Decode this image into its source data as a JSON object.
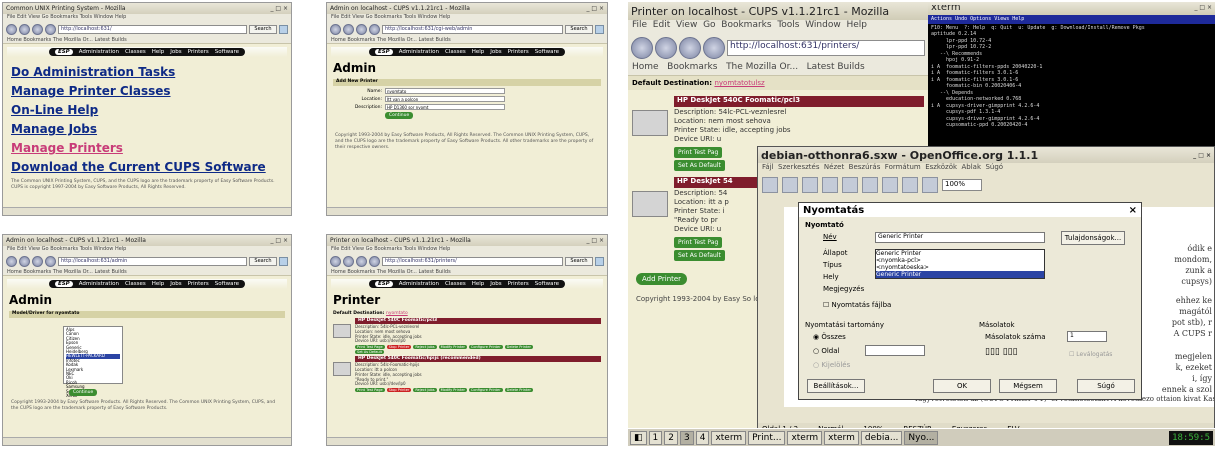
{
  "screens": {
    "s1": {
      "title": "Common UNIX Printing System - Mozilla",
      "url": "http://localhost:631/",
      "links": [
        "Do Administration Tasks",
        "Manage Printer Classes",
        "On-Line Help",
        "Manage Jobs",
        "Manage Printers",
        "Download the Current CUPS Software"
      ],
      "footer": "The Common UNIX Printing System, CUPS, and the CUPS logo are the trademark property of Easy Software Products. CUPS is copyright 1997-2004 by Easy Software Products, All Rights Reserved."
    },
    "s2": {
      "title": "Admin on localhost - CUPS v1.1.21rc1 - Mozilla",
      "url": "http://localhost:631/cgi-web/admin",
      "heading": "Admin",
      "section": "Add New Printer",
      "fields": [
        {
          "label": "Name:",
          "value": "nyomtato"
        },
        {
          "label": "Location:",
          "value": "Itt van a polcon"
        },
        {
          "label": "Description:",
          "value": "HP D1360 sor nyomt"
        }
      ],
      "button": "Continue",
      "footer": "Copyright 1993-2004 by Easy Software Products, All Rights Reserved. The Common UNIX Printing System, CUPS, and the CUPS logo are the trademark property of Easy Software Products. All other trademarks are the property of their respective owners."
    },
    "s3": {
      "title": "Admin on localhost - CUPS v1.1.21rc1 - Mozilla",
      "url": "http://localhost:631/admin",
      "heading": "Admin",
      "section": "Model/Driver for nyomtato",
      "list_label": "Driver:",
      "list": [
        "Alps",
        "Canon",
        "Citizen",
        "Epson",
        "Generic",
        "Heidelberg",
        "HEWLETT-PACKARD",
        "Infotec",
        "Kodak",
        "Lexmark",
        "NEC",
        "Oki",
        "Ricoh",
        "Samsung",
        "Seiko",
        "Xerox"
      ],
      "selected_index": 6,
      "button": "Continue",
      "footer": "Copyright 1993-2004 by Easy Software Products. All Rights Reserved. The Common UNIX Printing System, CUPS, and the CUPS logo are the trademark property of Easy Software Products."
    },
    "s4": {
      "title": "Printer on localhost - CUPS v1.1.21rc1 - Mozilla",
      "url": "http://localhost:631/printers/",
      "heading": "Printer",
      "default_dest": "Default Destination:",
      "default_link": "nyomtato",
      "printers": [
        {
          "name": "HP DeskJet 540C Foomatic/pcl3",
          "lines": [
            "Description: 54lc-PCL-veznlesrel",
            "Location: nem most sehova",
            "Printer State: idle, accepting jobs",
            "Device URI: usb://dev/lp0"
          ]
        },
        {
          "name": "HP DeskJet 540C Foomatic/hpijs (recommended)",
          "lines": [
            "Description: 54lc-Foomatic-hpijs",
            "Location: itt a polcon",
            "Printer State: idle, accepting jobs",
            "\"Ready to print.\"",
            "Device URI: usb://dev/lp0"
          ]
        }
      ],
      "buttons": [
        "Print Test Page",
        "Stop Printer",
        "Reject Jobs",
        "Modify Printer",
        "Configure Printer",
        "Delete Printer",
        "Set As Default"
      ]
    },
    "big": {
      "mozilla_title": "Printer on localhost - CUPS v1.1.21rc1 - Mozilla",
      "menu": [
        "File",
        "Edit",
        "View",
        "Go",
        "Bookmarks",
        "Tools",
        "Window",
        "Help"
      ],
      "url": "http://localhost:631/printers/",
      "bookmarks": [
        "Home",
        "Bookmarks",
        "The Mozilla Or...",
        "Latest Builds"
      ],
      "default_dest": "Default Destination:",
      "default_link": "nyomtatotulsz",
      "printers": [
        {
          "name": "HP DeskJet 540C Foomatic/pcl3",
          "lines": [
            "Description: 54lc-PCL-veznlesrel",
            "Location: nem most sehova",
            "Printer State: idle, accepting jobs",
            "Device URI: u"
          ]
        },
        {
          "name": "HP DeskJet 54",
          "lines": [
            "Description: 54",
            "Location: itt a p",
            "Printer State: i",
            "\"Ready to pr",
            "Device URI: u"
          ]
        }
      ],
      "btn_test": "Print Test Pag",
      "btn_default": "Set As Default",
      "add_printer": "Add Printer",
      "copyright": "Copyright 1993-2004 by Easy So logo are the trademark property o",
      "xterm_title": "xterm",
      "xterm_menu": "Actions  Undo  Options  Views  Help",
      "xterm_lines": [
        "F10: Menu  ?: Help  q: Quit  u: Update  g: Download/Install/Remove Pkgs",
        "aptitude 0.2.14",
        "     lpr-ppd 10.72-4",
        "     lpr-ppd 10.72-2",
        "   --\\ Recommends",
        "     hpoj 0.91-2",
        "i A  foomatic-filters-ppds 20040220-1",
        "i A  foomatic-filters 3.0.1-6",
        "i A  foomatic-filters 3.0.1-6",
        "     foomatic-bin 0.20020406-4",
        "   --\\ Depends",
        "     education-networked 0.768",
        "i A  cupsys-driver-gimpprint 4.2.6-4",
        "     cupsys-pdf 1.3.1-4",
        "     cupsys-driver-gimpprint 4.2.6-4",
        "     cupsomatic-ppd 0.20020420-4"
      ],
      "oo_title": "debian-otthonra6.sxw - OpenOffice.org 1.1.1",
      "oo_menu": [
        "Fájl",
        "Szerkesztés",
        "Nézet",
        "Beszúrás",
        "Formátum",
        "Eszközök",
        "Ablak",
        "Súgó"
      ],
      "oo_zoom": "100%",
      "oo_status": [
        "Oldal 1 / 2",
        "Normál",
        "100%",
        "BESZÚR",
        "Egyszeres",
        "ELV"
      ],
      "doc_text": [
        "ódik e",
        "mondom,",
        "zunk a",
        "cupsys)",
        "ehhez ke",
        "magától",
        "pot stb), r",
        "A CUPS r",
        "megjelen",
        "k, ezeket",
        "i, így",
        "ennek a szol",
        "Tagyvetveteten az (CUPS Printer #1) -el vetanotostaift A kovetkezo ottaion kivat Kasztatto"
      ],
      "dlg_title": "Nyomtatás",
      "dlg": {
        "printer_group": "Nyomtató",
        "name_label": "Név",
        "name_value": "Generic Printer",
        "props_btn": "Tulajdonságok...",
        "dropdown": [
          "Generic Printer",
          "<nyomka-pcl>",
          "<nyomtatoeska>",
          "Generic Printer"
        ],
        "status_label": "Állapot",
        "type_label": "Típus",
        "location_label": "Hely",
        "comment_label": "Megjegyzés",
        "to_file": "Nyomtatás fájlba",
        "range_group": "Nyomtatási tartomány",
        "all": "Összes",
        "pages": "Oldal",
        "selection": "Kijelölés",
        "copies_group": "Másolatok",
        "copies_label": "Másolatok száma",
        "copies_value": "1",
        "collate": "Leválogatás",
        "options_btn": "Beállítások...",
        "ok_btn": "OK",
        "cancel_btn": "Mégsem",
        "help_btn": "Súgó"
      },
      "taskbar": [
        "1",
        "2",
        "3",
        "4",
        "xterm",
        "Print...",
        "xterm",
        "xterm",
        "debia...",
        "Nyo..."
      ],
      "clock": "18:59:5"
    }
  }
}
